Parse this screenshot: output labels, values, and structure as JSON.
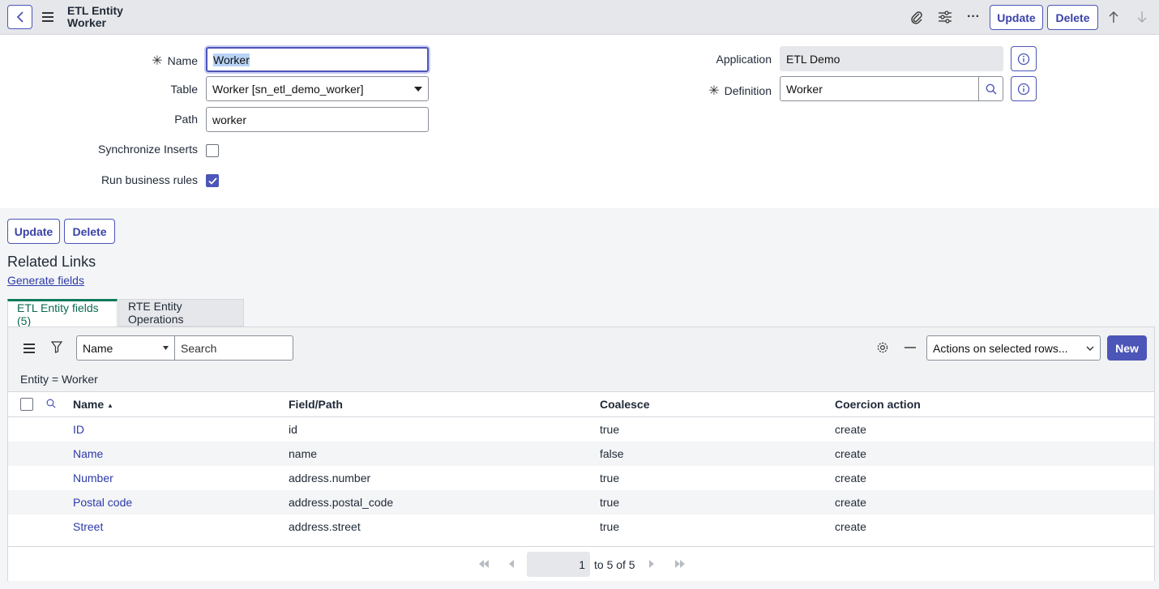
{
  "header": {
    "title_line1": "ETL Entity",
    "title_line2": "Worker",
    "update_label": "Update",
    "delete_label": "Delete"
  },
  "form": {
    "name_label": "Name",
    "name_value": "Worker",
    "table_label": "Table",
    "table_value": "Worker [sn_etl_demo_worker]",
    "path_label": "Path",
    "path_value": "worker",
    "sync_inserts_label": "Synchronize Inserts",
    "sync_inserts_checked": false,
    "run_rules_label": "Run business rules",
    "run_rules_checked": true,
    "application_label": "Application",
    "application_value": "ETL Demo",
    "definition_label": "Definition",
    "definition_value": "Worker",
    "required_mark": "✳"
  },
  "bottom_buttons": {
    "update_label": "Update",
    "delete_label": "Delete"
  },
  "related_links": {
    "heading": "Related Links",
    "generate_fields": "Generate fields"
  },
  "tabs": [
    {
      "label": "ETL Entity fields (5)",
      "active": true
    },
    {
      "label": "RTE Entity Operations",
      "active": false
    }
  ],
  "list": {
    "search_field_select": "Name",
    "search_placeholder": "Search",
    "actions_select": "Actions on selected rows...",
    "new_label": "New",
    "filter_text": "Entity = Worker",
    "columns": [
      "Name",
      "Field/Path",
      "Coalesce",
      "Coercion action"
    ],
    "sort_indicator": "▲",
    "rows": [
      {
        "name": "ID",
        "path": "id",
        "coalesce": "true",
        "coercion": "create"
      },
      {
        "name": "Name",
        "path": "name",
        "coalesce": "false",
        "coercion": "create"
      },
      {
        "name": "Number",
        "path": "address.number",
        "coalesce": "true",
        "coercion": "create"
      },
      {
        "name": "Postal code",
        "path": "address.postal_code",
        "coalesce": "true",
        "coercion": "create"
      },
      {
        "name": "Street",
        "path": "address.street",
        "coalesce": "true",
        "coercion": "create"
      }
    ],
    "pager": {
      "page": "1",
      "range_text": "to 5 of 5"
    }
  },
  "colors": {
    "accent": "#4c55b8",
    "tab_active": "#0b7a5a",
    "link": "#2d3aa8"
  }
}
